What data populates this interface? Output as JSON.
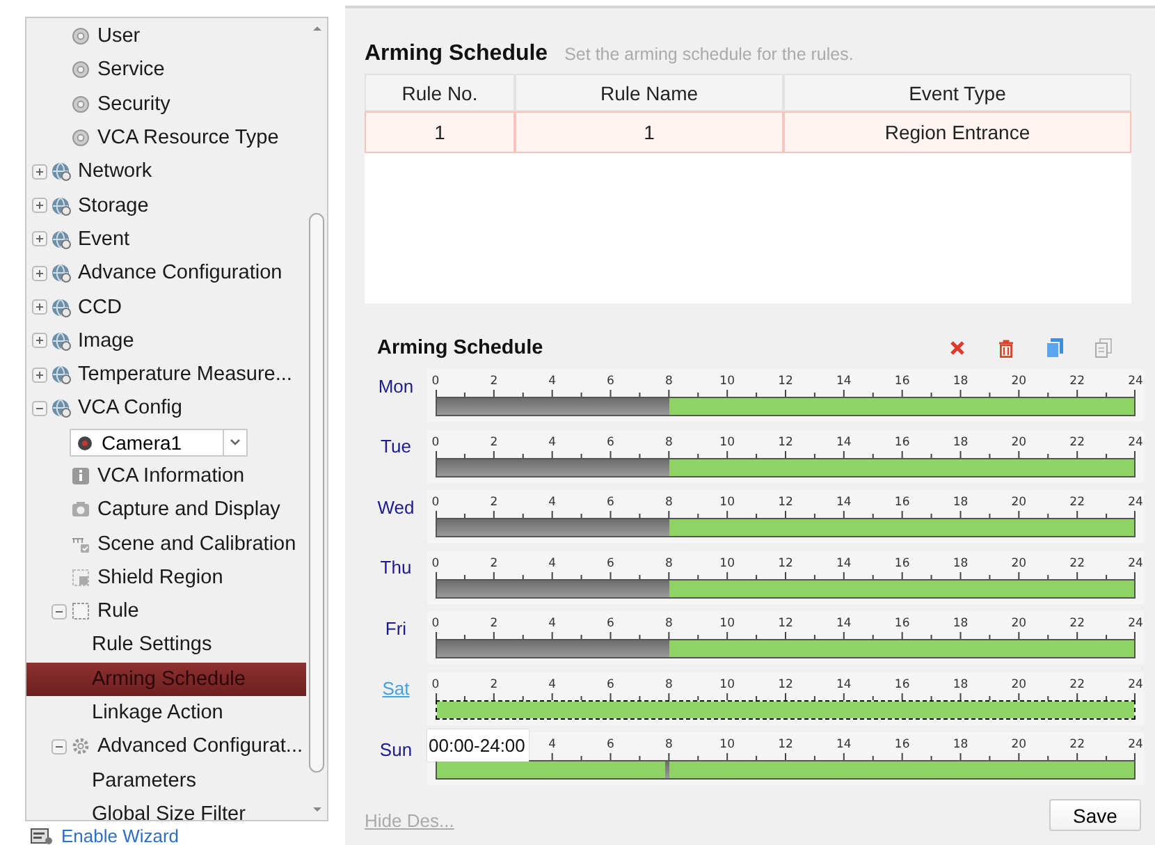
{
  "sidebar": {
    "items": [
      {
        "kind": "continued",
        "children": [
          {
            "label": "User",
            "kind": "page",
            "selected": false
          },
          {
            "label": "Service",
            "kind": "page",
            "selected": false
          },
          {
            "label": "Security",
            "kind": "page",
            "selected": false
          },
          {
            "label": "VCA Resource Type",
            "kind": "page",
            "selected": false
          }
        ]
      },
      {
        "label": "Network",
        "kind": "category",
        "expanded": false,
        "selected": false
      },
      {
        "label": "Storage",
        "kind": "category",
        "expanded": false,
        "selected": false
      },
      {
        "label": "Event",
        "kind": "category",
        "expanded": false,
        "selected": false
      },
      {
        "label": "Advance Configuration",
        "kind": "category",
        "expanded": false,
        "selected": false
      },
      {
        "label": "CCD",
        "kind": "category",
        "expanded": false,
        "selected": false
      },
      {
        "label": "Image",
        "kind": "category",
        "expanded": false,
        "selected": false
      },
      {
        "label": "Temperature Measure...",
        "kind": "category",
        "expanded": false,
        "selected": false
      },
      {
        "label": "VCA Config",
        "kind": "category",
        "expanded": true,
        "selected": false,
        "children": [
          {
            "label": "Camera1",
            "kind": "dropdown"
          },
          {
            "label": "VCA Information",
            "kind": "info",
            "selected": false
          },
          {
            "label": "Capture and Display",
            "kind": "capture",
            "selected": false
          },
          {
            "label": "Scene and Calibration",
            "kind": "scene",
            "selected": false
          },
          {
            "label": "Shield Region",
            "kind": "shield",
            "selected": false
          },
          {
            "label": "Rule",
            "kind": "rule",
            "expanded": true,
            "selected": false,
            "children": [
              {
                "label": "Rule Settings",
                "kind": "leaf",
                "selected": false
              },
              {
                "label": "Arming Schedule",
                "kind": "leaf",
                "selected": true
              },
              {
                "label": "Linkage Action",
                "kind": "leaf",
                "selected": false
              }
            ]
          },
          {
            "label": "Advanced Configurat...",
            "kind": "settings",
            "expanded": true,
            "selected": false,
            "children": [
              {
                "label": "Parameters",
                "kind": "leaf",
                "selected": false
              },
              {
                "label": "Global Size Filter",
                "kind": "leaf",
                "selected": false
              }
            ]
          }
        ]
      }
    ],
    "footer_link": "Enable Wizard"
  },
  "header": {
    "title": "Arming Schedule",
    "subtitle": "Set the arming schedule for the rules."
  },
  "table": {
    "columns": [
      "Rule No.",
      "Rule Name",
      "Event Type"
    ],
    "rows": [
      {
        "cells": [
          "1",
          "1",
          "Region Entrance"
        ],
        "selected": true
      }
    ]
  },
  "schedule": {
    "title": "Arming Schedule",
    "days": [
      {
        "label": "Mon",
        "selected": false,
        "ticks": [
          "0",
          "2",
          "4",
          "6",
          "8",
          "10",
          "12",
          "14",
          "16",
          "18",
          "20",
          "22",
          "24"
        ],
        "segments": [
          {
            "kind": "unarmed",
            "level": 0.3333
          },
          {
            "kind": "armed",
            "level": 0.6667
          }
        ]
      },
      {
        "label": "Tue",
        "selected": false,
        "ticks": [
          "0",
          "2",
          "4",
          "6",
          "8",
          "10",
          "12",
          "14",
          "16",
          "18",
          "20",
          "22",
          "24"
        ],
        "segments": [
          {
            "kind": "unarmed",
            "level": 0.3333
          },
          {
            "kind": "armed",
            "level": 0.6667
          }
        ]
      },
      {
        "label": "Wed",
        "selected": false,
        "ticks": [
          "0",
          "2",
          "4",
          "6",
          "8",
          "10",
          "12",
          "14",
          "16",
          "18",
          "20",
          "22",
          "24"
        ],
        "segments": [
          {
            "kind": "unarmed",
            "level": 0.3333
          },
          {
            "kind": "armed",
            "level": 0.6667
          }
        ]
      },
      {
        "label": "Thu",
        "selected": false,
        "ticks": [
          "0",
          "2",
          "4",
          "6",
          "8",
          "10",
          "12",
          "14",
          "16",
          "18",
          "20",
          "22",
          "24"
        ],
        "segments": [
          {
            "kind": "unarmed",
            "level": 0.3333
          },
          {
            "kind": "armed",
            "level": 0.6667
          }
        ]
      },
      {
        "label": "Fri",
        "selected": false,
        "ticks": [
          "0",
          "2",
          "4",
          "6",
          "8",
          "10",
          "12",
          "14",
          "16",
          "18",
          "20",
          "22",
          "24"
        ],
        "segments": [
          {
            "kind": "unarmed",
            "level": 0.3333
          },
          {
            "kind": "armed",
            "level": 0.6667
          }
        ]
      },
      {
        "label": "Sat",
        "selected": true,
        "ticks": [
          "0",
          "2",
          "4",
          "6",
          "8",
          "10",
          "12",
          "14",
          "16",
          "18",
          "20",
          "22",
          "24"
        ],
        "segments": [
          {
            "kind": "armed",
            "level": 1
          }
        ]
      },
      {
        "label": "Sun",
        "selected": false,
        "ticks": [
          "4",
          "6",
          "8",
          "10",
          "12",
          "14",
          "16",
          "18",
          "20",
          "22",
          "24"
        ],
        "segments": [
          {
            "kind": "armed",
            "level": 0.3264
          },
          {
            "kind": "unarmed",
            "level": 0.0069
          },
          {
            "kind": "armed",
            "level": 0.6667
          }
        ]
      }
    ],
    "tooltip": "00:00-24:00"
  },
  "hide_link": "Hide Des...",
  "save_button": "Save"
}
